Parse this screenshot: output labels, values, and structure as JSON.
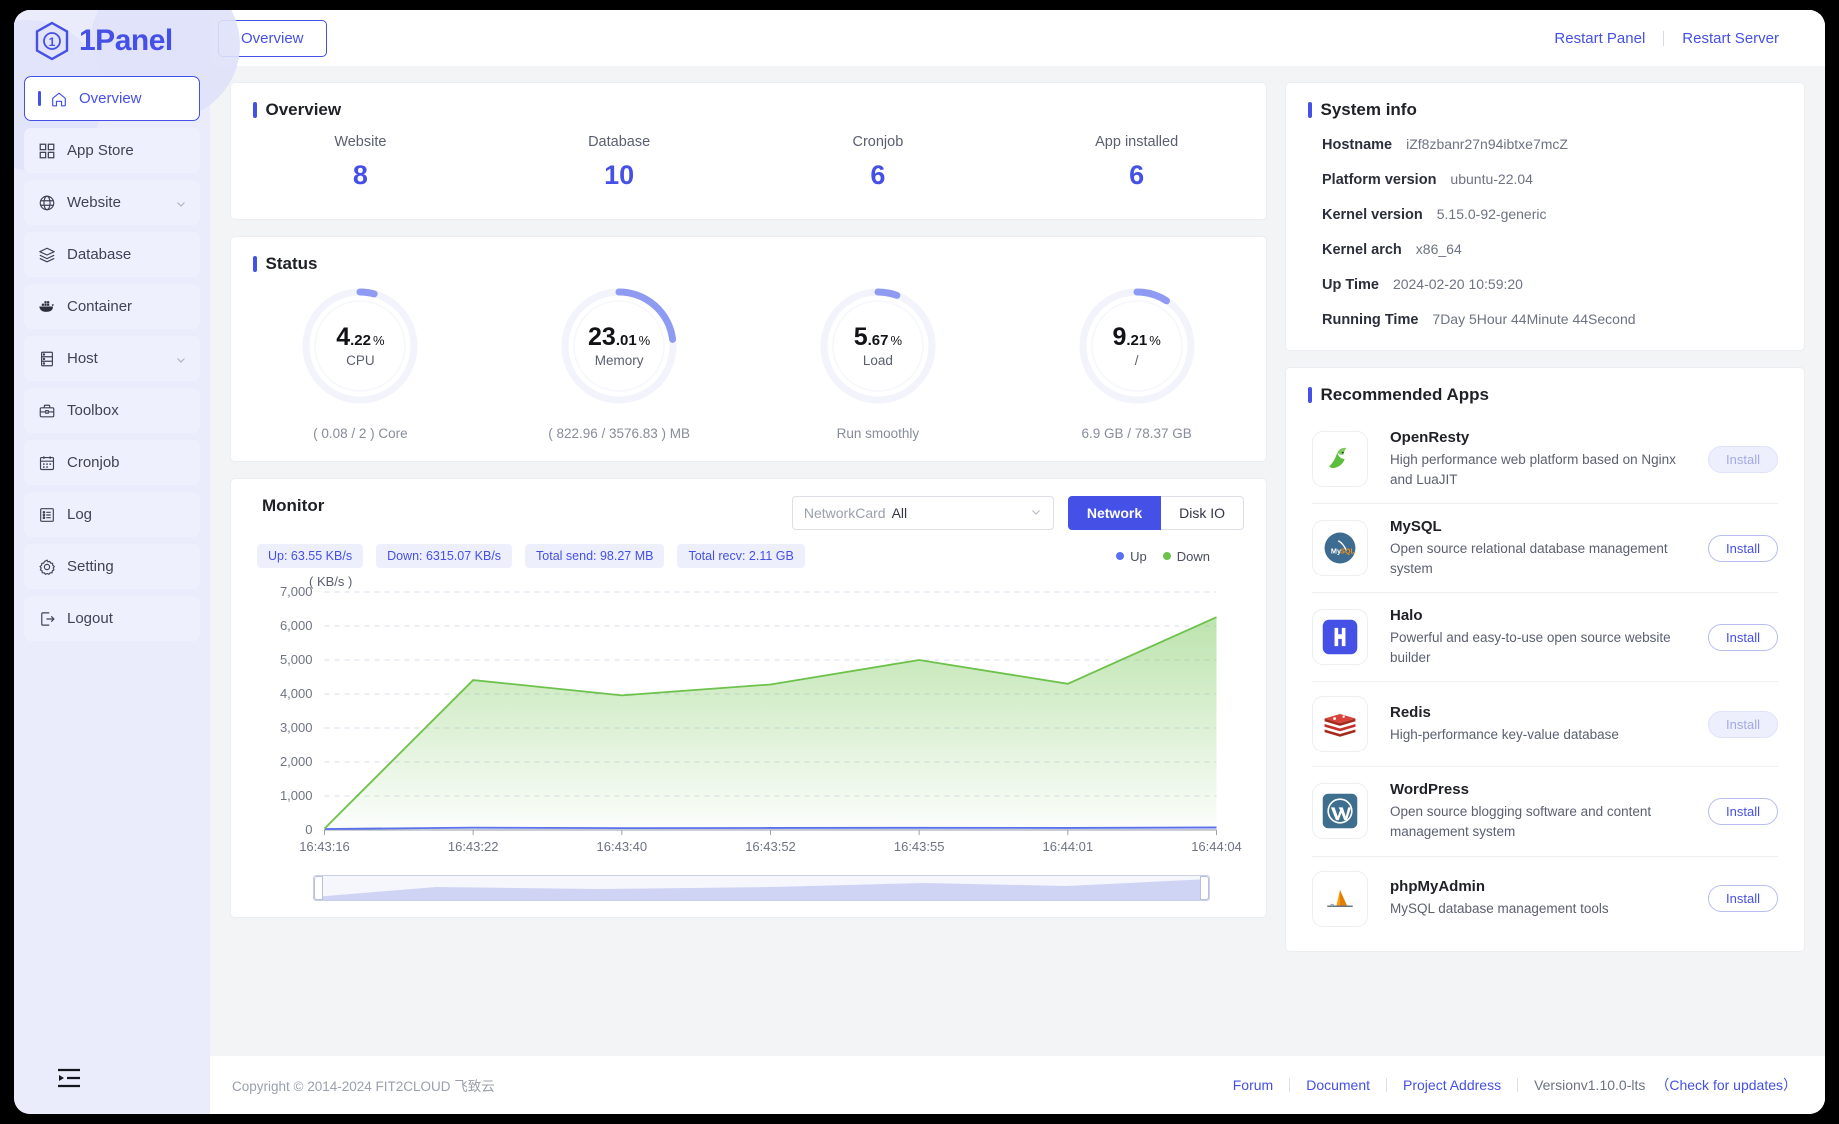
{
  "brand": {
    "name": "1Panel",
    "logo_icon": "hexagon-1-logo"
  },
  "sidebar": {
    "items": [
      {
        "label": "Overview",
        "icon": "home-icon",
        "active": true,
        "expandable": false
      },
      {
        "label": "App Store",
        "icon": "grid-apps-icon",
        "active": false,
        "expandable": false
      },
      {
        "label": "Website",
        "icon": "globe-icon",
        "active": false,
        "expandable": true
      },
      {
        "label": "Database",
        "icon": "database-layers-icon",
        "active": false,
        "expandable": false
      },
      {
        "label": "Container",
        "icon": "docker-whale-icon",
        "active": false,
        "expandable": false
      },
      {
        "label": "Host",
        "icon": "server-rack-icon",
        "active": false,
        "expandable": true
      },
      {
        "label": "Toolbox",
        "icon": "toolbox-icon",
        "active": false,
        "expandable": false
      },
      {
        "label": "Cronjob",
        "icon": "calendar-icon",
        "active": false,
        "expandable": false
      },
      {
        "label": "Log",
        "icon": "log-list-icon",
        "active": false,
        "expandable": false
      },
      {
        "label": "Setting",
        "icon": "gear-icon",
        "active": false,
        "expandable": false
      },
      {
        "label": "Logout",
        "icon": "logout-icon",
        "active": false,
        "expandable": false
      }
    ],
    "collapse_icon": "collapse-menu-icon"
  },
  "topbar": {
    "tab_label": "Overview",
    "restart_panel": "Restart Panel",
    "restart_server": "Restart Server"
  },
  "overview": {
    "title": "Overview",
    "stats": [
      {
        "label": "Website",
        "value": "8"
      },
      {
        "label": "Database",
        "value": "10"
      },
      {
        "label": "Cronjob",
        "value": "6"
      },
      {
        "label": "App installed",
        "value": "6"
      }
    ]
  },
  "status": {
    "title": "Status",
    "gauges": [
      {
        "name": "CPU",
        "int": "4",
        "dec": ".22",
        "unit": "%",
        "percent": 4.22,
        "sub": "( 0.08 / 2 ) Core"
      },
      {
        "name": "Memory",
        "int": "23",
        "dec": ".01",
        "unit": "%",
        "percent": 23.01,
        "sub": "( 822.96 / 3576.83 ) MB"
      },
      {
        "name": "Load",
        "int": "5",
        "dec": ".67",
        "unit": "%",
        "percent": 5.67,
        "sub": "Run smoothly"
      },
      {
        "name": "/",
        "int": "9",
        "dec": ".21",
        "unit": "%",
        "percent": 9.21,
        "sub": "6.9 GB / 78.37 GB"
      }
    ]
  },
  "monitor": {
    "title": "Monitor",
    "networkcard_placeholder": "NetworkCard",
    "networkcard_value": "All",
    "tabs": [
      {
        "label": "Network",
        "active": true
      },
      {
        "label": "Disk IO",
        "active": false
      }
    ],
    "chips": [
      "Up: 63.55 KB/s",
      "Down: 6315.07 KB/s",
      "Total send: 98.27 MB",
      "Total recv: 2.11 GB"
    ],
    "legend": [
      {
        "label": "Up",
        "color": "#5b6ff0"
      },
      {
        "label": "Down",
        "color": "#6cc24a"
      }
    ]
  },
  "chart_data": {
    "type": "area",
    "title": "",
    "unit_label": "( KB/s )",
    "xlabel": "",
    "ylabel": "KB/s",
    "ylim": [
      0,
      7000
    ],
    "yticks": [
      0,
      1000,
      2000,
      3000,
      4000,
      5000,
      6000,
      7000
    ],
    "ytick_labels": [
      "0",
      "1,000",
      "2,000",
      "3,000",
      "4,000",
      "5,000",
      "6,000",
      "7,000"
    ],
    "grid": true,
    "legend_position": "top-right",
    "x": [
      "16:43:16",
      "16:43:22",
      "16:43:40",
      "16:43:52",
      "16:43:55",
      "16:44:01",
      "16:44:04"
    ],
    "xtick_labels": [
      "16:43:16",
      "16:43:22",
      "16:43:40",
      "16:43:52",
      "16:43:55",
      "16:44:01",
      "16:44:04"
    ],
    "series": [
      {
        "name": "Down",
        "color": "#6cc24a",
        "values": [
          40,
          4410,
          3960,
          4280,
          5000,
          4300,
          6260
        ]
      },
      {
        "name": "Up",
        "color": "#5b6ff0",
        "values": [
          30,
          70,
          55,
          60,
          65,
          60,
          75
        ]
      }
    ]
  },
  "system_info": {
    "title": "System info",
    "rows": [
      {
        "key": "Hostname",
        "value": "iZf8zbanr27n94ibtxe7mcZ"
      },
      {
        "key": "Platform version",
        "value": "ubuntu-22.04"
      },
      {
        "key": "Kernel version",
        "value": "5.15.0-92-generic"
      },
      {
        "key": "Kernel arch",
        "value": "x86_64"
      },
      {
        "key": "Up Time",
        "value": "2024-02-20 10:59:20"
      },
      {
        "key": "Running Time",
        "value": "7Day 5Hour 44Minute 44Second"
      }
    ]
  },
  "recommended_apps": {
    "title": "Recommended Apps",
    "items": [
      {
        "name": "OpenResty",
        "desc": "High performance web platform based on Nginx and LuaJIT",
        "icon": "openresty-icon",
        "button": "Install",
        "muted": true
      },
      {
        "name": "MySQL",
        "desc": "Open source relational database management system",
        "icon": "mysql-icon",
        "button": "Install",
        "muted": false
      },
      {
        "name": "Halo",
        "desc": "Powerful and easy-to-use open source website builder",
        "icon": "halo-icon",
        "button": "Install",
        "muted": false
      },
      {
        "name": "Redis",
        "desc": "High-performance key-value database",
        "icon": "redis-icon",
        "button": "Install",
        "muted": true
      },
      {
        "name": "WordPress",
        "desc": "Open source blogging software and content management system",
        "icon": "wordpress-icon",
        "button": "Install",
        "muted": false
      },
      {
        "name": "phpMyAdmin",
        "desc": "MySQL database management tools",
        "icon": "phpmyadmin-icon",
        "button": "Install",
        "muted": false
      }
    ]
  },
  "footer": {
    "copyright": "Copyright © 2014-2024 FIT2CLOUD 飞致云",
    "links": [
      "Forum",
      "Document",
      "Project Address"
    ],
    "version": "Versionv1.10.0-lts",
    "check_updates": "（Check for updates）"
  },
  "colors": {
    "accent": "#4550e6",
    "sidebar_bg": "#eaecfb",
    "up": "#5b6ff0",
    "down": "#6cc24a"
  }
}
